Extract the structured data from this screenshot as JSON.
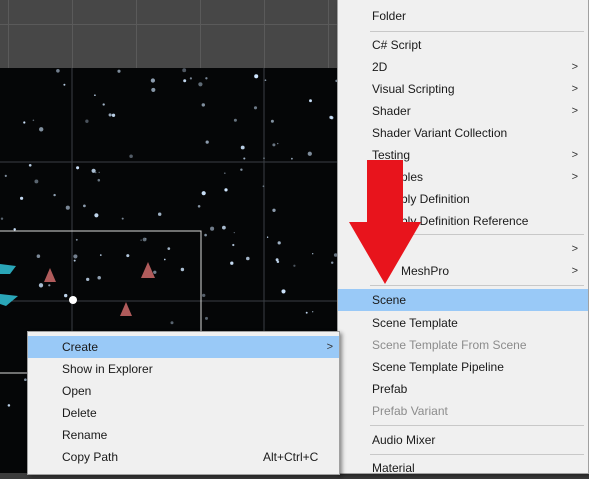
{
  "context_menu": {
    "items": [
      {
        "label": "Create",
        "submenu": true,
        "highlighted": true
      },
      {
        "label": "Show in Explorer"
      },
      {
        "label": "Open"
      },
      {
        "label": "Delete"
      },
      {
        "label": "Rename"
      },
      {
        "label": "Copy Path",
        "shortcut": "Alt+Ctrl+C"
      }
    ]
  },
  "create_submenu": {
    "items": [
      {
        "label": "Folder"
      },
      {
        "label": "C# Script"
      },
      {
        "label": "2D",
        "submenu": true
      },
      {
        "label": "Visual Scripting",
        "submenu": true
      },
      {
        "label": "Shader",
        "submenu": true
      },
      {
        "label": "Shader Variant Collection"
      },
      {
        "label": "Testing",
        "submenu": true
      },
      {
        "label": "ples",
        "submenu": true
      },
      {
        "label": "bly Definition"
      },
      {
        "label": "bly Definition Reference"
      },
      {
        "label": "",
        "submenu": true
      },
      {
        "label": "MeshPro",
        "submenu": true
      },
      {
        "label": "Scene",
        "highlighted": true
      },
      {
        "label": "Scene Template"
      },
      {
        "label": "Scene Template From Scene",
        "disabled": true
      },
      {
        "label": "Scene Template Pipeline"
      },
      {
        "label": "Prefab"
      },
      {
        "label": "Prefab Variant",
        "disabled": true
      },
      {
        "label": "Audio Mixer"
      },
      {
        "label": "Material"
      }
    ]
  },
  "submenu_arrow_glyph": ">",
  "colors": {
    "menu_bg": "#f0f0f0",
    "highlight": "#99c9f7",
    "disabled_text": "#8c8c8c",
    "annotation_arrow": "#e8141c"
  }
}
